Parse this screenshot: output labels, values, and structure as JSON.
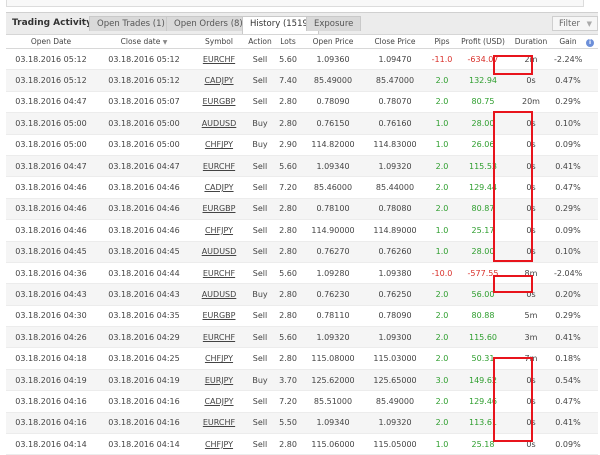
{
  "panel": {
    "title": "Trading Activity",
    "tabs": [
      {
        "label": "Open Trades (1)"
      },
      {
        "label": "Open Orders (8)"
      },
      {
        "label": "History (1519)"
      },
      {
        "label": "Exposure"
      }
    ],
    "filter_label": "Filter",
    "filter_icon": "triangle-down-icon"
  },
  "table": {
    "headers": {
      "open_date": "Open Date",
      "close_date": "Close date",
      "close_sort_icon": "▼",
      "symbol": "Symbol",
      "action": "Action",
      "lots": "Lots",
      "open_price": "Open Price",
      "close_price": "Close Price",
      "pips": "Pips",
      "profit": "Profit (USD)",
      "duration": "Duration",
      "gain": "Gain",
      "info_icon": "info-icon"
    },
    "rows": [
      [
        "03.18.2016 05:12",
        "03.18.2016 05:12",
        "EURCHF",
        "Sell",
        "5.60",
        "1.09360",
        "1.09470",
        "-11.0",
        "-634.07",
        "2m",
        "-2.24%"
      ],
      [
        "03.18.2016 05:12",
        "03.18.2016 05:12",
        "CADJPY",
        "Sell",
        "7.40",
        "85.49000",
        "85.47000",
        "2.0",
        "132.94",
        "0s",
        "0.47%"
      ],
      [
        "03.18.2016 04:47",
        "03.18.2016 05:07",
        "EURGBP",
        "Sell",
        "2.80",
        "0.78090",
        "0.78070",
        "2.0",
        "80.75",
        "20m",
        "0.29%"
      ],
      [
        "03.18.2016 05:00",
        "03.18.2016 05:00",
        "AUDUSD",
        "Buy",
        "2.80",
        "0.76150",
        "0.76160",
        "1.0",
        "28.00",
        "0s",
        "0.10%"
      ],
      [
        "03.18.2016 05:00",
        "03.18.2016 05:00",
        "CHFJPY",
        "Buy",
        "2.90",
        "114.82000",
        "114.83000",
        "1.0",
        "26.06",
        "0s",
        "0.09%"
      ],
      [
        "03.18.2016 04:47",
        "03.18.2016 04:47",
        "EURCHF",
        "Sell",
        "5.60",
        "1.09340",
        "1.09320",
        "2.0",
        "115.53",
        "0s",
        "0.41%"
      ],
      [
        "03.18.2016 04:46",
        "03.18.2016 04:46",
        "CADJPY",
        "Sell",
        "7.20",
        "85.46000",
        "85.44000",
        "2.0",
        "129.44",
        "0s",
        "0.47%"
      ],
      [
        "03.18.2016 04:46",
        "03.18.2016 04:46",
        "EURGBP",
        "Sell",
        "2.80",
        "0.78100",
        "0.78080",
        "2.0",
        "80.87",
        "0s",
        "0.29%"
      ],
      [
        "03.18.2016 04:46",
        "03.18.2016 04:46",
        "CHFJPY",
        "Sell",
        "2.80",
        "114.90000",
        "114.89000",
        "1.0",
        "25.17",
        "0s",
        "0.09%"
      ],
      [
        "03.18.2016 04:45",
        "03.18.2016 04:45",
        "AUDUSD",
        "Sell",
        "2.80",
        "0.76270",
        "0.76260",
        "1.0",
        "28.00",
        "0s",
        "0.10%"
      ],
      [
        "03.18.2016 04:36",
        "03.18.2016 04:44",
        "EURCHF",
        "Sell",
        "5.60",
        "1.09280",
        "1.09380",
        "-10.0",
        "-577.55",
        "8m",
        "-2.04%"
      ],
      [
        "03.18.2016 04:43",
        "03.18.2016 04:43",
        "AUDUSD",
        "Buy",
        "2.80",
        "0.76230",
        "0.76250",
        "2.0",
        "56.00",
        "0s",
        "0.20%"
      ],
      [
        "03.18.2016 04:30",
        "03.18.2016 04:35",
        "EURGBP",
        "Sell",
        "2.80",
        "0.78110",
        "0.78090",
        "2.0",
        "80.88",
        "5m",
        "0.29%"
      ],
      [
        "03.18.2016 04:26",
        "03.18.2016 04:29",
        "EURCHF",
        "Sell",
        "5.60",
        "1.09320",
        "1.09300",
        "2.0",
        "115.60",
        "3m",
        "0.41%"
      ],
      [
        "03.18.2016 04:18",
        "03.18.2016 04:25",
        "CHFJPY",
        "Sell",
        "2.80",
        "115.08000",
        "115.03000",
        "2.0",
        "50.31",
        "7m",
        "0.18%"
      ],
      [
        "03.18.2016 04:19",
        "03.18.2016 04:19",
        "EURJPY",
        "Buy",
        "3.70",
        "125.62000",
        "125.65000",
        "3.0",
        "149.62",
        "0s",
        "0.54%"
      ],
      [
        "03.18.2016 04:16",
        "03.18.2016 04:16",
        "CADJPY",
        "Sell",
        "7.20",
        "85.51000",
        "85.49000",
        "2.0",
        "129.46",
        "0s",
        "0.47%"
      ],
      [
        "03.18.2016 04:16",
        "03.18.2016 04:16",
        "EURCHF",
        "Sell",
        "5.50",
        "1.09340",
        "1.09320",
        "2.0",
        "113.61",
        "0s",
        "0.41%"
      ],
      [
        "03.18.2016 04:14",
        "03.18.2016 04:14",
        "CHFJPY",
        "Sell",
        "2.80",
        "115.06000",
        "115.05000",
        "1.0",
        "25.18",
        "0s",
        "0.09%"
      ]
    ]
  },
  "colors": {
    "positive": "#2e9e2e",
    "negative": "#d9302a",
    "highlight_box": "#e8141c"
  }
}
